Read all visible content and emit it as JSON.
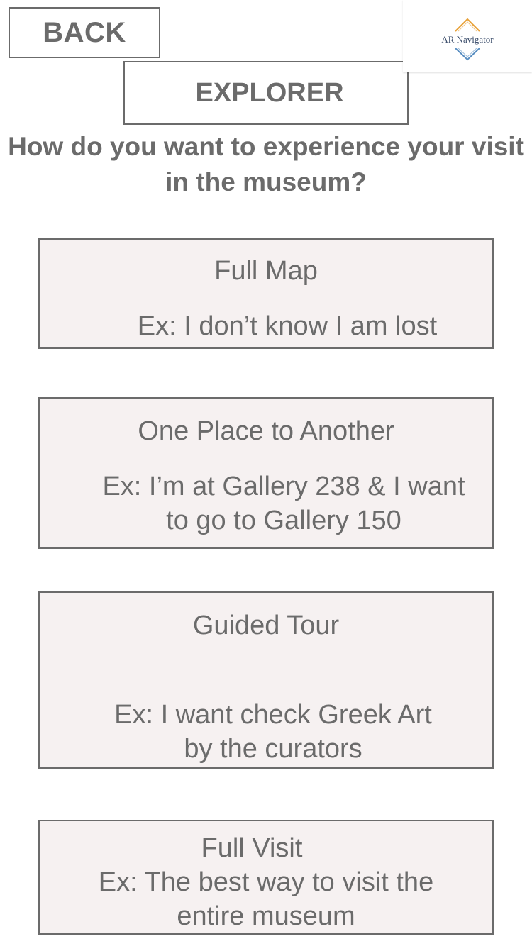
{
  "header": {
    "back_label": "BACK",
    "mode_label": "EXPLORER",
    "logo_text": "AR Navigator",
    "logo_colors": {
      "top_chevron": "#e8a23a",
      "bottom_chevron": "#5a8fc2",
      "text": "#3a4c6a"
    }
  },
  "question": "How do you want to experience your visit in the museum?",
  "options": [
    {
      "title": "Full Map",
      "example": "Ex: I don’t know I am lost"
    },
    {
      "title": "One Place to Another",
      "example": "Ex: I’m at Gallery 238 & I want\nto go to Gallery 150"
    },
    {
      "title": "Guided Tour",
      "example": "Ex: I want check Greek Art\nby the curators"
    },
    {
      "title": "Full Visit",
      "example": "Ex: The best way to visit the\nentire museum"
    }
  ],
  "colors": {
    "text": "#6b6b6b",
    "border": "#6b6b6b",
    "card_background": "#f6f1f1"
  }
}
